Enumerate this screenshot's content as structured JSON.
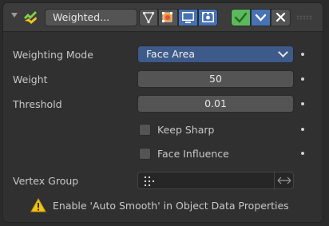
{
  "header": {
    "modifier_name": "Weighted...",
    "icons": [
      "expand-arrow-icon",
      "weighted-normal-modifier-icon",
      "edit-mode-cage-icon",
      "edit-mode-icon",
      "viewport-display-icon",
      "render-icon",
      "apply-icon",
      "dropdown-chevron-icon",
      "close-icon",
      "drag-grip-icon"
    ]
  },
  "fields": {
    "weighting_mode_label": "Weighting Mode",
    "weighting_mode_value": "Face Area",
    "weight_label": "Weight",
    "weight_value": "50",
    "threshold_label": "Threshold",
    "threshold_value": "0.01",
    "keep_sharp_label": "Keep Sharp",
    "keep_sharp_checked": false,
    "face_influence_label": "Face Influence",
    "face_influence_checked": false,
    "vertex_group_label": "Vertex Group",
    "vertex_group_value": ""
  },
  "warning": {
    "text": "Enable 'Auto Smooth' in Object Data Properties"
  },
  "colors": {
    "panel_bg": "#303030",
    "header_bg": "#3c3c3c",
    "field_bg": "#545454",
    "dropdown_bg": "#3d5a8a",
    "apply_green": "#5cb85c",
    "active_blue": "#4772b3",
    "warning_yellow": "#f0c419"
  }
}
